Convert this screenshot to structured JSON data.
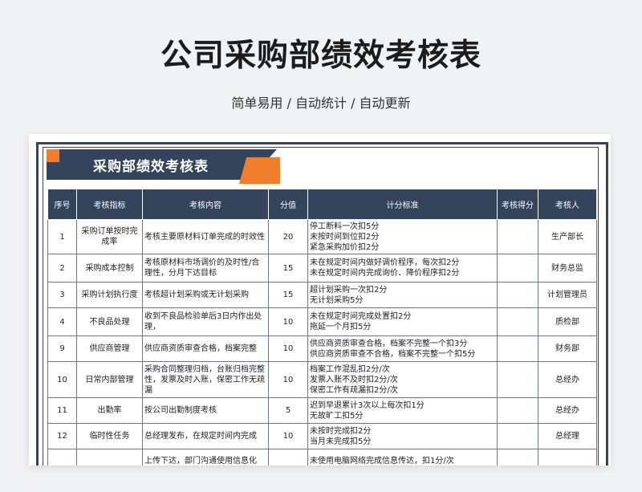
{
  "header": {
    "title": "公司采购部绩效考核表",
    "subtitle": "简单易用 / 自动统计 / 自动更新"
  },
  "sheet": {
    "banner_title": "采购部绩效考核表",
    "columns": [
      "序号",
      "考核指标",
      "考核内容",
      "分值",
      "计分标准",
      "考核得分",
      "考核人"
    ],
    "rows": [
      {
        "no": "1",
        "indicator": "采购订单按时完成率",
        "content": "考核主要原材料订单完成的时效性",
        "score": "20",
        "standard": [
          "停工断料一次扣5分",
          "未按时间到位扣2分",
          "紧急采购加价扣2分"
        ],
        "result": "",
        "reviewer": "生产部长"
      },
      {
        "no": "2",
        "indicator": "采购成本控制",
        "content": "考核原材料市场调价的及时性/合理性，分月下达目标",
        "score": "15",
        "standard": [
          "未在规定时间内做好调价程序，每次扣2分",
          "未在规定时间内完成询价、降价程序扣2分"
        ],
        "result": "",
        "reviewer": "财务总监"
      },
      {
        "no": "3",
        "indicator": "采购计划执行度",
        "content": "考核超计划采购或无计划采购",
        "score": "15",
        "standard": [
          "超计划采购一次扣2分",
          "无计划采购5分"
        ],
        "result": "",
        "reviewer": "计划管理员"
      },
      {
        "no": "4",
        "indicator": "不良品处理",
        "content": "收到不良品检验单后3日内作出处理，",
        "score": "10",
        "standard": [
          "未在规定时间完成处置扣2分",
          "拖延一个月扣5分"
        ],
        "result": "",
        "reviewer": "质检部"
      },
      {
        "no": "9",
        "indicator": "供应商管理",
        "content": "供应商资质审查合格，档案完整",
        "score": "10",
        "standard": [
          "供应商资质审查合格，档案不完整一个扣3分",
          "供应商资质审查不合格，档案不完整一个扣5分"
        ],
        "result": "",
        "reviewer": "财务部"
      },
      {
        "no": "10",
        "indicator": "日常内部管理",
        "content": "采购合同整理归档，台账归档完整性，发票及时入账，保密工作无疏漏",
        "score": "10",
        "standard": [
          "档案工作混乱扣2分/次",
          "发票入账不及时扣2分/次",
          "保密工作有疏漏扣2分/次"
        ],
        "result": "",
        "reviewer": "总经办"
      },
      {
        "no": "11",
        "indicator": "出勤率",
        "content": "按公司出勤制度考核",
        "score": "5",
        "standard": [
          "迟到早退累计3次以上每次扣1分",
          "无故旷工扣5分"
        ],
        "result": "",
        "reviewer": "总经办"
      },
      {
        "no": "12",
        "indicator": "临时性任务",
        "content": "总经理发布，在规定时间内完成",
        "score": "10",
        "standard": [
          "未按时完成扣2分",
          "当月未完成扣5分"
        ],
        "result": "",
        "reviewer": "总经理"
      },
      {
        "no": "",
        "indicator": "",
        "content": "上传下达，部门沟通使用信息化",
        "score": "",
        "standard": [
          "未使用电脑网络完成信息传达，扣1分/次"
        ],
        "result": "",
        "reviewer": ""
      }
    ]
  },
  "colors": {
    "navy": "#34445c",
    "orange": "#f07e2a",
    "background": "#f1f2f4"
  }
}
